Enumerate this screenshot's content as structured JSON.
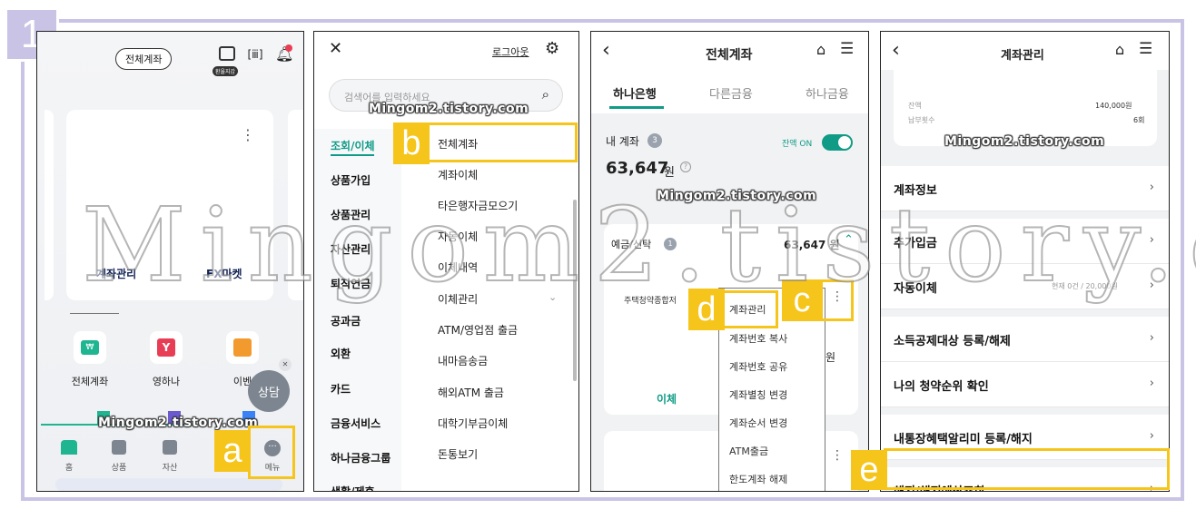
{
  "step": "1",
  "watermark": "Mingom2.tistory.com",
  "big_watermark": "Mingom2.tistory.com",
  "labels": {
    "a": "a",
    "b": "b",
    "c": "c",
    "d": "d",
    "e": "e"
  },
  "panel1": {
    "account_pill": "전체계좌",
    "wallet_badge": "환율지갑",
    "card_links": [
      "계좌관리",
      "FX마켓"
    ],
    "quick": [
      "전체계좌",
      "영하나",
      "이벤"
    ],
    "consult": "상담",
    "nav": [
      "홈",
      "상품",
      "자산",
      "메뉴"
    ],
    "colors": {
      "won": "#1fb591",
      "y": "#e83e55",
      "gift": "#f29a2e"
    }
  },
  "panel2": {
    "search_placeholder": "검색어를 입력하세요",
    "logout": "로그아웃",
    "categories": [
      "조회/이체",
      "상품가입",
      "상품관리",
      "자산관리",
      "퇴직연금",
      "공과금",
      "외환",
      "카드",
      "금융서비스",
      "하나금융그룹",
      "생활/제휴"
    ],
    "subitems": [
      "전체계좌",
      "계좌이체",
      "타은행자금모으기",
      "자동이체",
      "이체내역",
      "이체관리",
      "ATM/영업점 출금",
      "내마음송금",
      "해외ATM 출금",
      "대학기부금이체",
      "돈통보기"
    ]
  },
  "panel3": {
    "title": "전체계좌",
    "tabs": [
      "하나은행",
      "다른금융",
      "하나금융"
    ],
    "my_account_label": "내 계좌",
    "my_account_count": "3",
    "balance_toggle_label": "잔액 ON",
    "total": "63,647",
    "won": "원",
    "section_label": "예금/신탁",
    "section_count": "1",
    "section_amount": "63,647 원",
    "product_name": "주택청약종합저",
    "partial_won": "원",
    "transfer": "이체",
    "menu": [
      "계좌관리",
      "계좌번호 복사",
      "계좌번호 공유",
      "계좌별칭 변경",
      "계좌순서 변경",
      "ATM출금",
      "한도계좌 해제"
    ],
    "accent": "#109b86"
  },
  "panel4": {
    "title": "계좌관리",
    "summary": [
      {
        "label": "잔액",
        "value": "140,000원"
      },
      {
        "label": "납부횟수",
        "value": "6회"
      }
    ],
    "rows": [
      "계좌정보",
      "추가입금",
      "자동이체",
      "소득공제대상 등록/해제",
      "나의 청약순위 확인",
      "내통장혜택알리미 등록/해지",
      "해지/해지예상조회"
    ],
    "auto_transfer_info": "현재 0건 / 20,000원"
  }
}
